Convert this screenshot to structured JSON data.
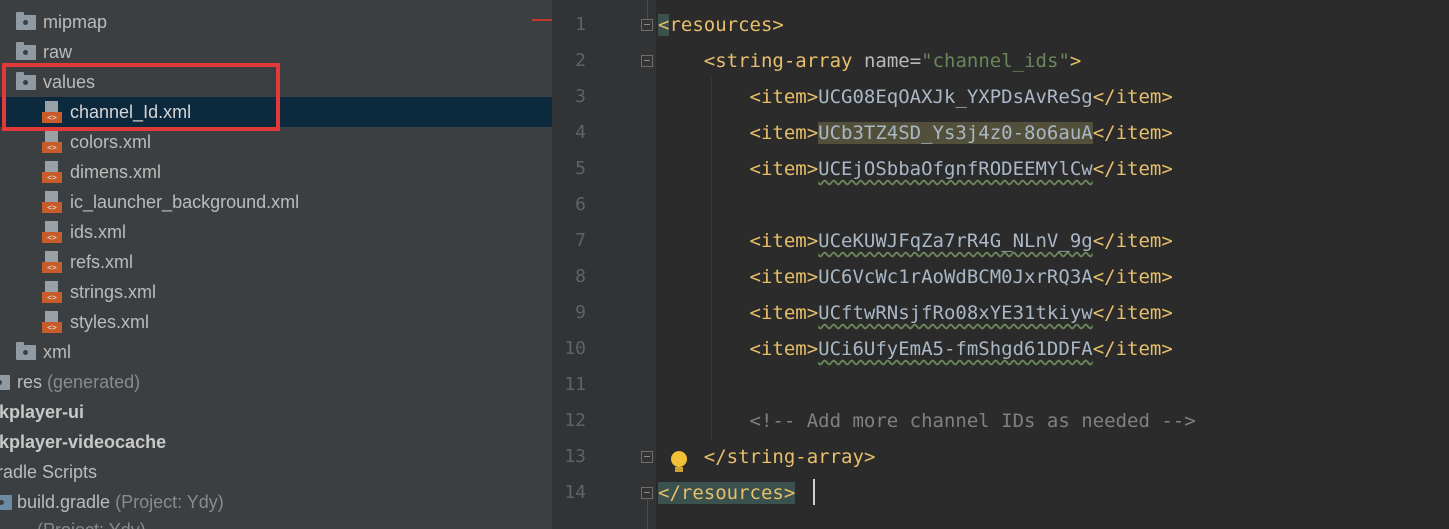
{
  "project_tree": {
    "items": [
      {
        "label": "mipmap",
        "icon": "folder-icon"
      },
      {
        "label": "raw",
        "icon": "folder-icon"
      },
      {
        "label": "values",
        "icon": "folder-icon"
      },
      {
        "label": "channel_Id.xml",
        "icon": "xml-file-icon",
        "selected": true
      },
      {
        "label": "colors.xml",
        "icon": "xml-file-icon"
      },
      {
        "label": "dimens.xml",
        "icon": "xml-file-icon"
      },
      {
        "label": "ic_launcher_background.xml",
        "icon": "xml-file-icon"
      },
      {
        "label": "ids.xml",
        "icon": "xml-file-icon"
      },
      {
        "label": "refs.xml",
        "icon": "xml-file-icon"
      },
      {
        "label": "strings.xml",
        "icon": "xml-file-icon"
      },
      {
        "label": "styles.xml",
        "icon": "xml-file-icon"
      },
      {
        "label": "xml",
        "icon": "folder-icon"
      },
      {
        "label": "res",
        "hint": "(generated)",
        "icon": "folder-icon"
      },
      {
        "label": "kplayer-ui"
      },
      {
        "label": "kplayer-videocache"
      },
      {
        "label": "radle Scripts"
      },
      {
        "label": "build.gradle",
        "hint": "(Project: Ydy)",
        "icon": "gradle-icon"
      },
      {
        "label": "...",
        "hint": "(Project: Ydy)"
      }
    ],
    "xml_tag": "<>"
  },
  "editor": {
    "line_numbers": [
      "1",
      "2",
      "3",
      "4",
      "5",
      "6",
      "7",
      "8",
      "9",
      "10",
      "11",
      "12",
      "13",
      "14"
    ],
    "lines": {
      "l1": {
        "open": "<",
        "tag": "resources",
        "close": ">"
      },
      "l2": {
        "open": "<",
        "tag": "string-array",
        "attr": "name",
        "eq": "=",
        "value": "\"channel_ids\"",
        "close": ">"
      },
      "l3": {
        "item_open": "<item>",
        "text": "UCG08EqOAXJk_YXPDsAvReSg",
        "item_close": "</item>"
      },
      "l4": {
        "item_open": "<item>",
        "text": "UCb3TZ4SD_Ys3j4z0-8o6auA",
        "item_close": "</item>"
      },
      "l5": {
        "item_open": "<item>",
        "text": "UCEjOSbbaOfgnfRODEEMYlCw",
        "item_close": "</item>"
      },
      "l7": {
        "item_open": "<item>",
        "text": "UCeKUWJFqZa7rR4G_NLnV_9g",
        "item_close": "</item>"
      },
      "l8": {
        "item_open": "<item>",
        "text": "UC6VcWc1rAoWdBCM0JxrRQ3A",
        "item_close": "</item>"
      },
      "l9": {
        "item_open": "<item>",
        "text": "UCftwRNsjfRo08xYE31tkiyw",
        "item_close": "</item>"
      },
      "l10": {
        "item_open": "<item>",
        "text": "UCi6UfyEmA5-fmShgd61DDFA",
        "item_close": "</item>"
      },
      "l12": {
        "comment": "<!-- Add more channel IDs as needed -->"
      },
      "l13": {
        "open": "</",
        "tag": "string-array",
        "close": ">"
      },
      "l14": {
        "open": "</",
        "tag": "resources",
        "close": ">"
      }
    }
  },
  "colors": {
    "tree_bg": "#3c3f41",
    "selection_bg": "#0d293e",
    "editor_bg": "#2b2b2b",
    "tag": "#e8bf6a",
    "attr_value": "#6a8759",
    "highlight_box": "#e23a3a"
  }
}
